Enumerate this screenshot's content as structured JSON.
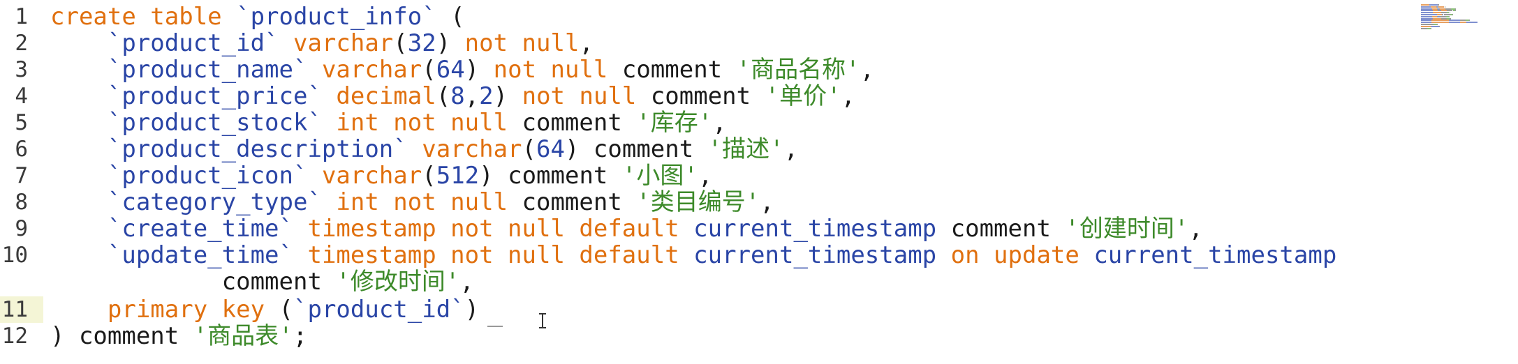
{
  "editor": {
    "lines": [
      {
        "n": "1",
        "tokens": [
          {
            "t": "create table ",
            "c": "kw"
          },
          {
            "t": "`product_info`",
            "c": "id"
          },
          {
            "t": " (",
            "c": "pl"
          }
        ]
      },
      {
        "n": "2",
        "tokens": [
          {
            "t": "    `product_id`",
            "c": "id"
          },
          {
            "t": " varchar",
            "c": "kw"
          },
          {
            "t": "(",
            "c": "pl"
          },
          {
            "t": "32",
            "c": "num"
          },
          {
            "t": ")",
            "c": "pl"
          },
          {
            "t": " not null",
            "c": "kw"
          },
          {
            "t": ",",
            "c": "pl"
          }
        ]
      },
      {
        "n": "3",
        "tokens": [
          {
            "t": "    `product_name`",
            "c": "id"
          },
          {
            "t": " varchar",
            "c": "kw"
          },
          {
            "t": "(",
            "c": "pl"
          },
          {
            "t": "64",
            "c": "num"
          },
          {
            "t": ")",
            "c": "pl"
          },
          {
            "t": " not null",
            "c": "kw"
          },
          {
            "t": " comment ",
            "c": "pl"
          },
          {
            "t": "'商品名称'",
            "c": "str"
          },
          {
            "t": ",",
            "c": "pl"
          }
        ]
      },
      {
        "n": "4",
        "tokens": [
          {
            "t": "    `product_price`",
            "c": "id"
          },
          {
            "t": " decimal",
            "c": "kw"
          },
          {
            "t": "(",
            "c": "pl"
          },
          {
            "t": "8",
            "c": "num"
          },
          {
            "t": ",",
            "c": "pl"
          },
          {
            "t": "2",
            "c": "num"
          },
          {
            "t": ")",
            "c": "pl"
          },
          {
            "t": " not null",
            "c": "kw"
          },
          {
            "t": " comment ",
            "c": "pl"
          },
          {
            "t": "'单价'",
            "c": "str"
          },
          {
            "t": ",",
            "c": "pl"
          }
        ]
      },
      {
        "n": "5",
        "tokens": [
          {
            "t": "    `product_stock`",
            "c": "id"
          },
          {
            "t": " int not null",
            "c": "kw"
          },
          {
            "t": " comment ",
            "c": "pl"
          },
          {
            "t": "'库存'",
            "c": "str"
          },
          {
            "t": ",",
            "c": "pl"
          }
        ]
      },
      {
        "n": "6",
        "tokens": [
          {
            "t": "    `product_description`",
            "c": "id"
          },
          {
            "t": " varchar",
            "c": "kw"
          },
          {
            "t": "(",
            "c": "pl"
          },
          {
            "t": "64",
            "c": "num"
          },
          {
            "t": ")",
            "c": "pl"
          },
          {
            "t": " comment ",
            "c": "pl"
          },
          {
            "t": "'描述'",
            "c": "str"
          },
          {
            "t": ",",
            "c": "pl"
          }
        ]
      },
      {
        "n": "7",
        "tokens": [
          {
            "t": "    `product_icon`",
            "c": "id"
          },
          {
            "t": " varchar",
            "c": "kw"
          },
          {
            "t": "(",
            "c": "pl"
          },
          {
            "t": "512",
            "c": "num"
          },
          {
            "t": ")",
            "c": "pl"
          },
          {
            "t": " comment ",
            "c": "pl"
          },
          {
            "t": "'小图'",
            "c": "str"
          },
          {
            "t": ",",
            "c": "pl"
          }
        ]
      },
      {
        "n": "8",
        "tokens": [
          {
            "t": "    `category_type`",
            "c": "id"
          },
          {
            "t": " int not null",
            "c": "kw"
          },
          {
            "t": " comment ",
            "c": "pl"
          },
          {
            "t": "'类目编号'",
            "c": "str"
          },
          {
            "t": ",",
            "c": "pl"
          }
        ]
      },
      {
        "n": "9",
        "tokens": [
          {
            "t": "    `create_time`",
            "c": "id"
          },
          {
            "t": " timestamp not null default",
            "c": "kw"
          },
          {
            "t": " current_timestamp",
            "c": "id"
          },
          {
            "t": " comment ",
            "c": "pl"
          },
          {
            "t": "'创建时间'",
            "c": "str"
          },
          {
            "t": ",",
            "c": "pl"
          }
        ]
      },
      {
        "n": "10",
        "tokens": [
          {
            "t": "    `update_time`",
            "c": "id"
          },
          {
            "t": " timestamp not null default",
            "c": "kw"
          },
          {
            "t": " current_timestamp",
            "c": "id"
          },
          {
            "t": " on update",
            "c": "kw"
          },
          {
            "t": " current_timestamp",
            "c": "id"
          }
        ]
      },
      {
        "n": "",
        "tokens": [
          {
            "t": "            comment ",
            "c": "pl"
          },
          {
            "t": "'修改时间'",
            "c": "str"
          },
          {
            "t": ",",
            "c": "pl"
          }
        ]
      },
      {
        "n": "11",
        "tokens": [
          {
            "t": "    primary key",
            "c": "kw"
          },
          {
            "t": " (",
            "c": "pl"
          },
          {
            "t": "`product_id`",
            "c": "id"
          },
          {
            "t": ")",
            "c": "pl"
          }
        ]
      },
      {
        "n": "12",
        "tokens": [
          {
            "t": ") comment ",
            "c": "pl"
          },
          {
            "t": "'商品表'",
            "c": "str"
          },
          {
            "t": ";",
            "c": "pl"
          }
        ]
      }
    ],
    "current_line": "11"
  }
}
